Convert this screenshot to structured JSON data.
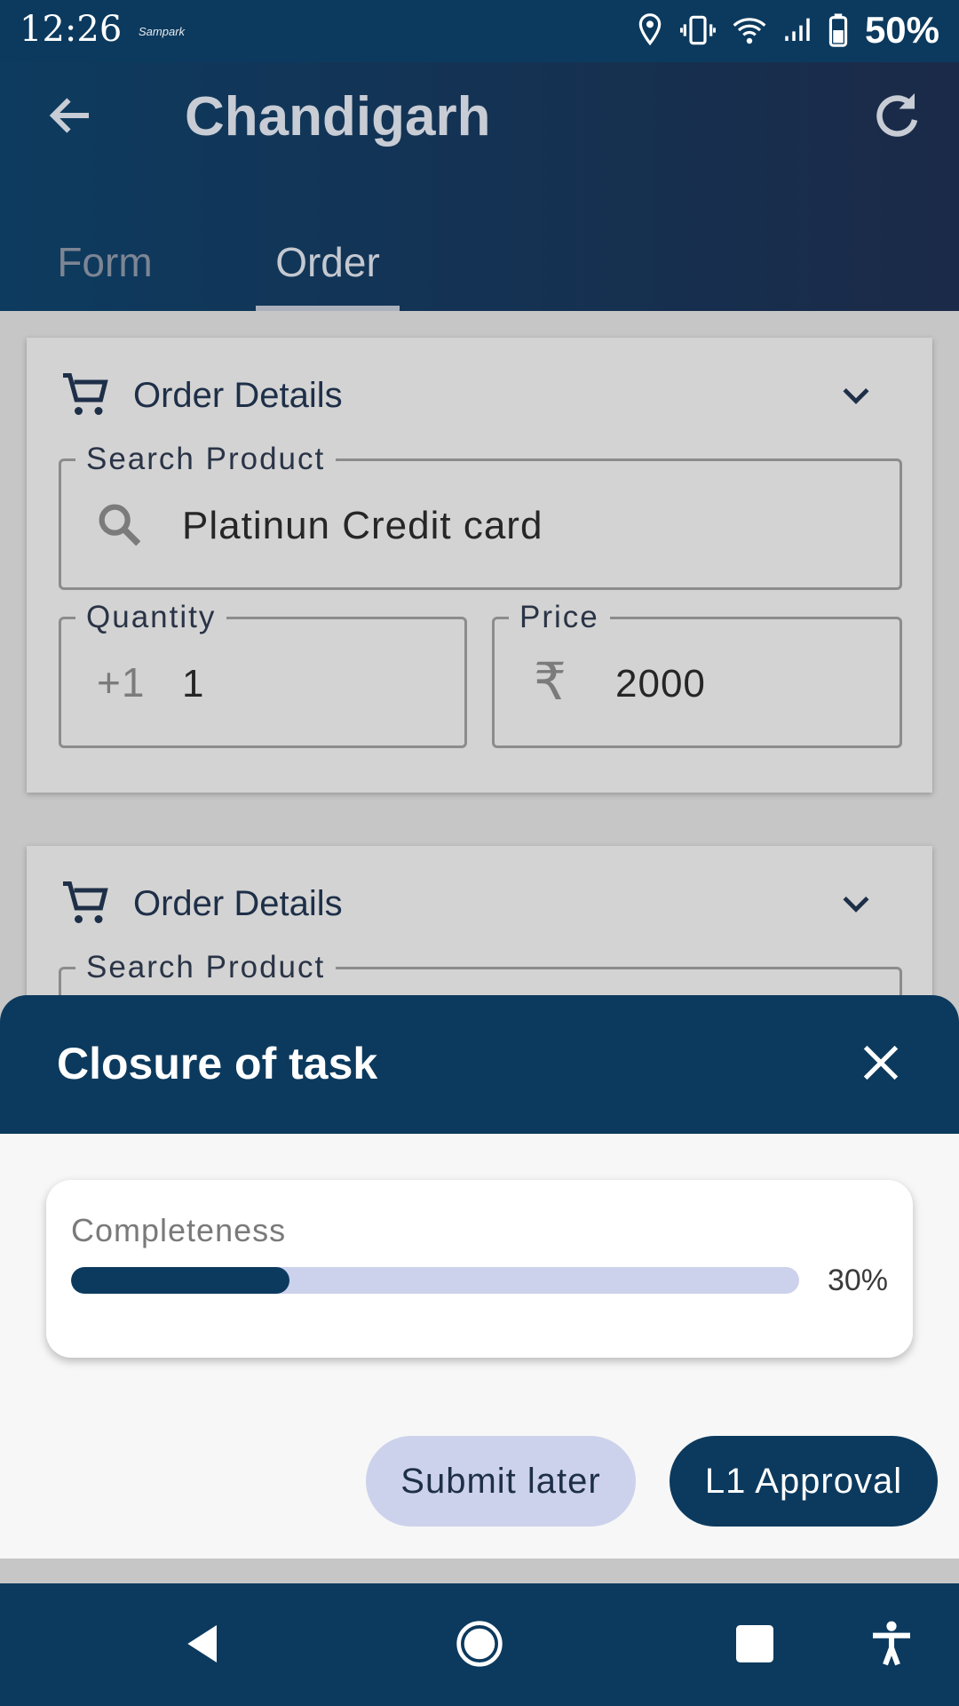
{
  "status_bar": {
    "time": "12:26",
    "carrier": "Sampark",
    "battery": "50%"
  },
  "app_bar": {
    "title": "Chandigarh",
    "back_icon": "arrow-left-icon",
    "refresh_icon": "refresh-icon"
  },
  "tabs": [
    {
      "label": "Form",
      "selected": false
    },
    {
      "label": "Order",
      "selected": true
    }
  ],
  "order_cards": [
    {
      "title": "Order Details",
      "search": {
        "label": "Search Product",
        "value": "Platinun Credit card"
      },
      "quantity": {
        "label": "Quantity",
        "prefix": "+1",
        "value": "1"
      },
      "price": {
        "label": "Price",
        "prefix": "₹",
        "value": "2000"
      }
    },
    {
      "title": "Order Details",
      "search": {
        "label": "Search Product",
        "value": ""
      }
    }
  ],
  "sheet": {
    "title": "Closure of task",
    "completeness": {
      "label": "Completeness",
      "value": 0.3,
      "text": "30%"
    },
    "submit_later_label": "Submit later",
    "approval_label": "L1 Approval"
  },
  "colors": {
    "primary": "#0c3a5e",
    "accent_light": "#cdd2ec",
    "overlay_content": "#c6c6c6"
  }
}
